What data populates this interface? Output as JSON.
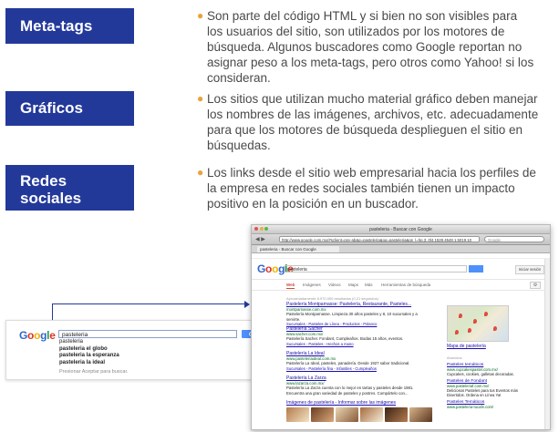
{
  "labels": {
    "meta": "Meta-tags",
    "graficos": "Gráficos",
    "redes_1": "Redes",
    "redes_2": "sociales"
  },
  "bullets": {
    "meta_lines": [
      "Son parte del código HTML y si bien no son visibles para",
      "los usuarios del sitio, son utilizados por los motores de",
      "búsqueda. Algunos buscadores como Google reportan no",
      "asignar peso a los meta-tags, pero otros como Yahoo! si los",
      "consideran."
    ],
    "graficos_lines": [
      "Los sitios que utilizan mucho material gráfico deben manejar",
      "los nombres de las imágenes, archivos, etc. adecuadamente",
      "para que los motores de búsqueda desplieguen el sitio en",
      "búsquedas."
    ],
    "redes_lines": [
      "Los links desde el sitio web empresarial hacia los perfiles de",
      "la empresa en redes sociales también tienen un impacto",
      "positivo en la posición en un buscador."
    ]
  },
  "suggest": {
    "logo": [
      "G",
      "o",
      "o",
      "g",
      "l",
      "e"
    ],
    "query": "pasteleria",
    "items": [
      "pasteleria",
      "pasteleria el globo",
      "pasteleria la esperanza",
      "pasteleria la ideal"
    ],
    "footer": "Presionar Aceptar para buscar."
  },
  "browser": {
    "title": "pasteleria - Buscar con Google",
    "url": "http://www.google.com.mx/#sclient=psy-ab&q=pasteleria&oq=pasteleria&gs_l=hp.3..0l4.1528.4548.1.5019.10",
    "search_placeholder": "Google",
    "tab": "pasteleria - Buscar con Google",
    "logo": [
      "G",
      "o",
      "o",
      "g",
      "l",
      "e"
    ],
    "query": "pasteleria",
    "signin": "Iniciar sesión",
    "tabs": [
      "Web",
      "Imágenes",
      "Videos",
      "Maps",
      "Más",
      "Herramientas de búsqueda"
    ],
    "gear": "⚙",
    "stats": "Aproximadamente 8.970.000 resultados (0,21 segundos)",
    "results": [
      {
        "title": "Pastelería Montparnasse: Pastelería, Restaurante, Pasteles...",
        "url": "montparnasse.com.mx",
        "snip": "Pastelería Montparnasse. Limpieza 30 años pasteles y 8, 10 sucursales y a servirte.",
        "extra": "Sucursales - Pasteles de Línea - Productos - Polanco"
      },
      {
        "title": "Pastelería Sacher",
        "url": "www.sacher.com.mx/",
        "snip": "Pastelería Sacher. Fondant, Cumpleaños. Bodas 15 años, eventos.",
        "extra": "Sucursales - Pasteles - Hechos a mano"
      },
      {
        "title": "Pastelería La Ideal",
        "url": "www.pasteleriaideal.com.mx",
        "snip": "Pastelería La Ideal, pasteles, panadería. Desde 1927 sabor tradicional.",
        "extra": "Sucursales - Pastelería fina - Infantiles - Cumpleaños"
      },
      {
        "title": "Pastelería La Zarza",
        "url": "www.lazarza.com.mx/",
        "snip": "Pastelería La Zarza cuenta con lo mejor en tartas y pasteles desde 1981.",
        "extra": "Encuentra una gran variedad de pasteles y postres. Compártelo con..."
      }
    ],
    "images_link": "Imágenes de pastelería - Informar sobre las imágenes",
    "map_link": "Mapa de pastelería",
    "ads_header": "Anuncios",
    "ads": [
      {
        "title": "Pasteles temáticos",
        "url": "www.cupcakespastel.com.mx/",
        "snip": "Cupcakes, cookies, galletas decoradas."
      },
      {
        "title": "Pasteles de Fondant",
        "url": "www.pasteleriaf.com.mx/",
        "snip": "Deliciosos Pasteles para tus Eventos más Divertidos. Ordena en Línea Ya!"
      },
      {
        "title": "Pasteles Temáticos",
        "url": "www.pasteleria-tucafe.com/",
        "snip": ""
      }
    ]
  },
  "colors": {
    "label_bg": "#23399a",
    "bullet": "#e8a33a",
    "text": "#4a4a4a"
  }
}
